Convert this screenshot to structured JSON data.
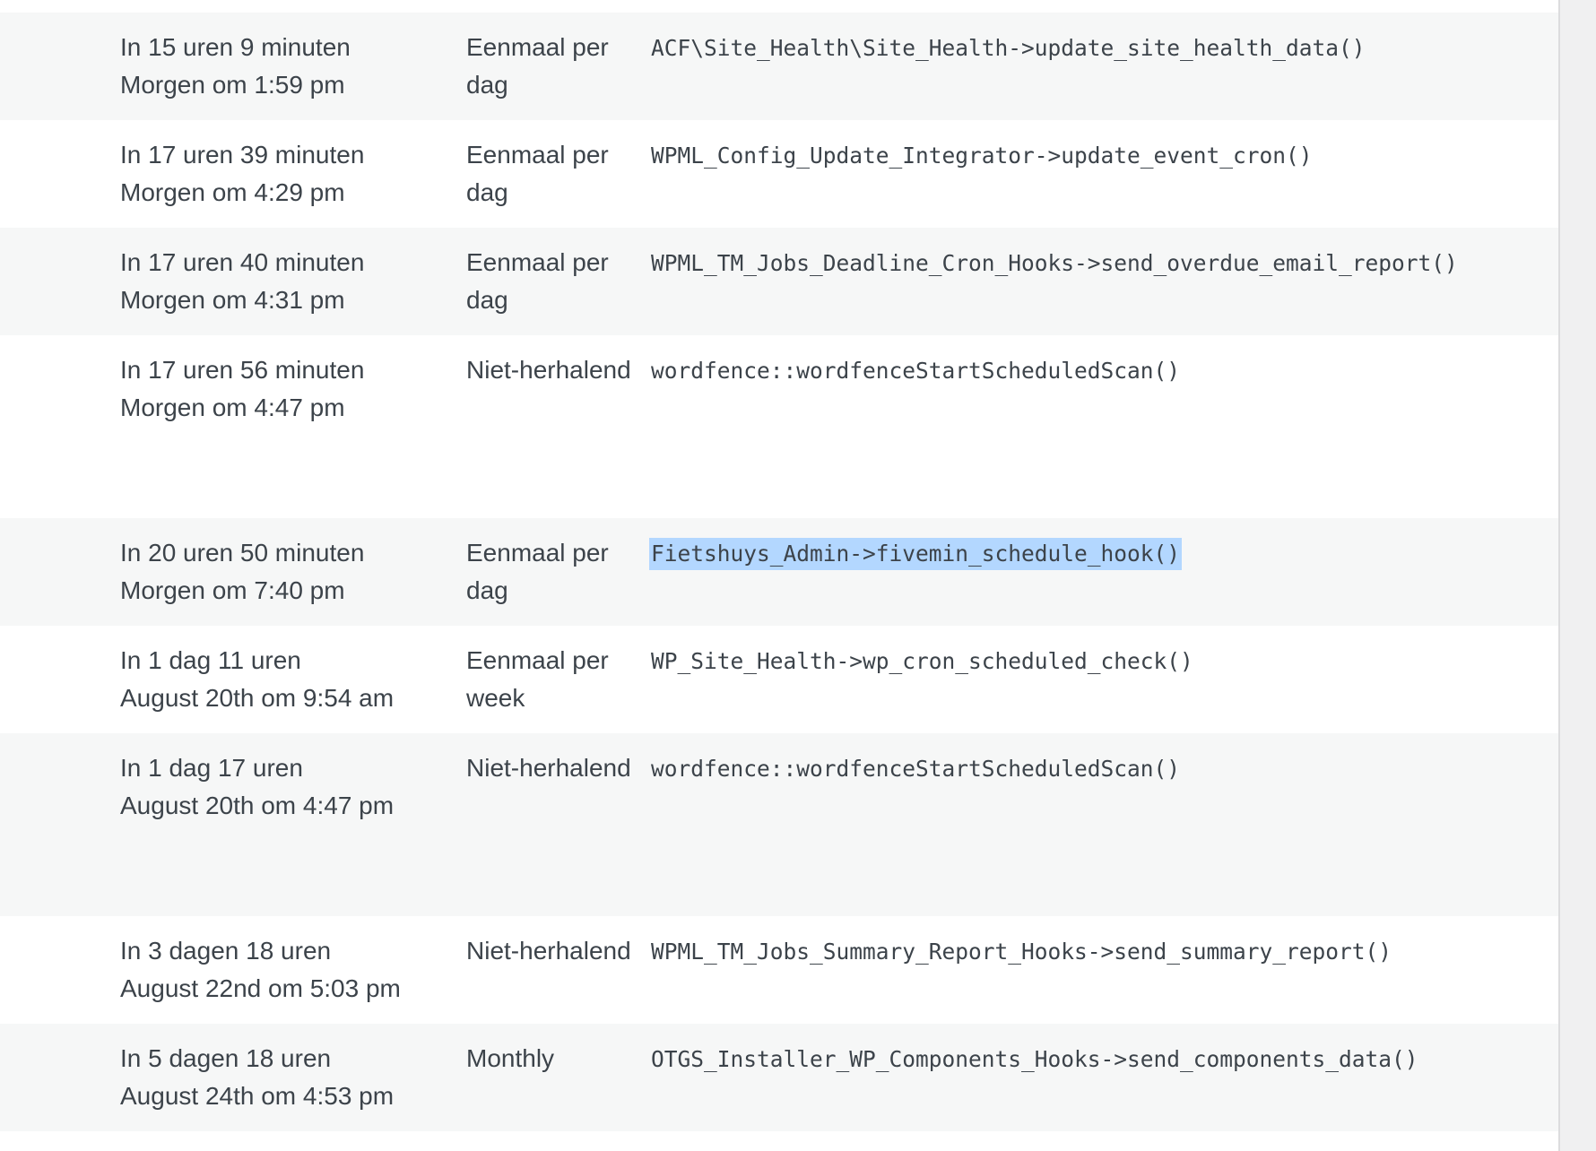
{
  "cron_table": {
    "rows": [
      {
        "when_relative": "In 15 uren 9 minuten",
        "when_absolute": "Morgen om 1:59 pm",
        "frequency": "Eenmaal per dag",
        "hook": "ACF\\Site_Health\\Site_Health->update_site_health_data()"
      },
      {
        "when_relative": "In 17 uren 39 minuten",
        "when_absolute": "Morgen om 4:29 pm",
        "frequency": "Eenmaal per dag",
        "hook": "WPML_Config_Update_Integrator->update_event_cron()"
      },
      {
        "when_relative": "In 17 uren 40 minuten",
        "when_absolute": "Morgen om 4:31 pm",
        "frequency": "Eenmaal per dag",
        "hook": "WPML_TM_Jobs_Deadline_Cron_Hooks->send_overdue_email_report()"
      },
      {
        "when_relative": "In 17 uren 56 minuten",
        "when_absolute": "Morgen om 4:47 pm",
        "frequency": "Niet-herhalend",
        "hook": "wordfence::wordfenceStartScheduledScan()"
      },
      {
        "when_relative": "In 20 uren 50 minuten",
        "when_absolute": "Morgen om 7:40 pm",
        "frequency": "Eenmaal per dag",
        "hook": "Fietshuys_Admin->fivemin_schedule_hook()"
      },
      {
        "when_relative": "In 1 dag 11 uren",
        "when_absolute": "August 20th om 9:54 am",
        "frequency": "Eenmaal per week",
        "hook": "WP_Site_Health->wp_cron_scheduled_check()"
      },
      {
        "when_relative": "In 1 dag 17 uren",
        "when_absolute": "August 20th om 4:47 pm",
        "frequency": "Niet-herhalend",
        "hook": "wordfence::wordfenceStartScheduledScan()"
      },
      {
        "when_relative": "In 3 dagen 18 uren",
        "when_absolute": "August 22nd om 5:03 pm",
        "frequency": "Niet-herhalend",
        "hook": "WPML_TM_Jobs_Summary_Report_Hooks->send_summary_report()"
      },
      {
        "when_relative": "In 5 dagen 18 uren",
        "when_absolute": "August 24th om 4:53 pm",
        "frequency": "Monthly",
        "hook": "OTGS_Installer_WP_Components_Hooks->send_components_data()"
      }
    ]
  },
  "colors": {
    "text": "#3c434a",
    "stripe": "#f6f7f7",
    "selection": "#b3d7ff",
    "background": "#f0f0f1"
  }
}
